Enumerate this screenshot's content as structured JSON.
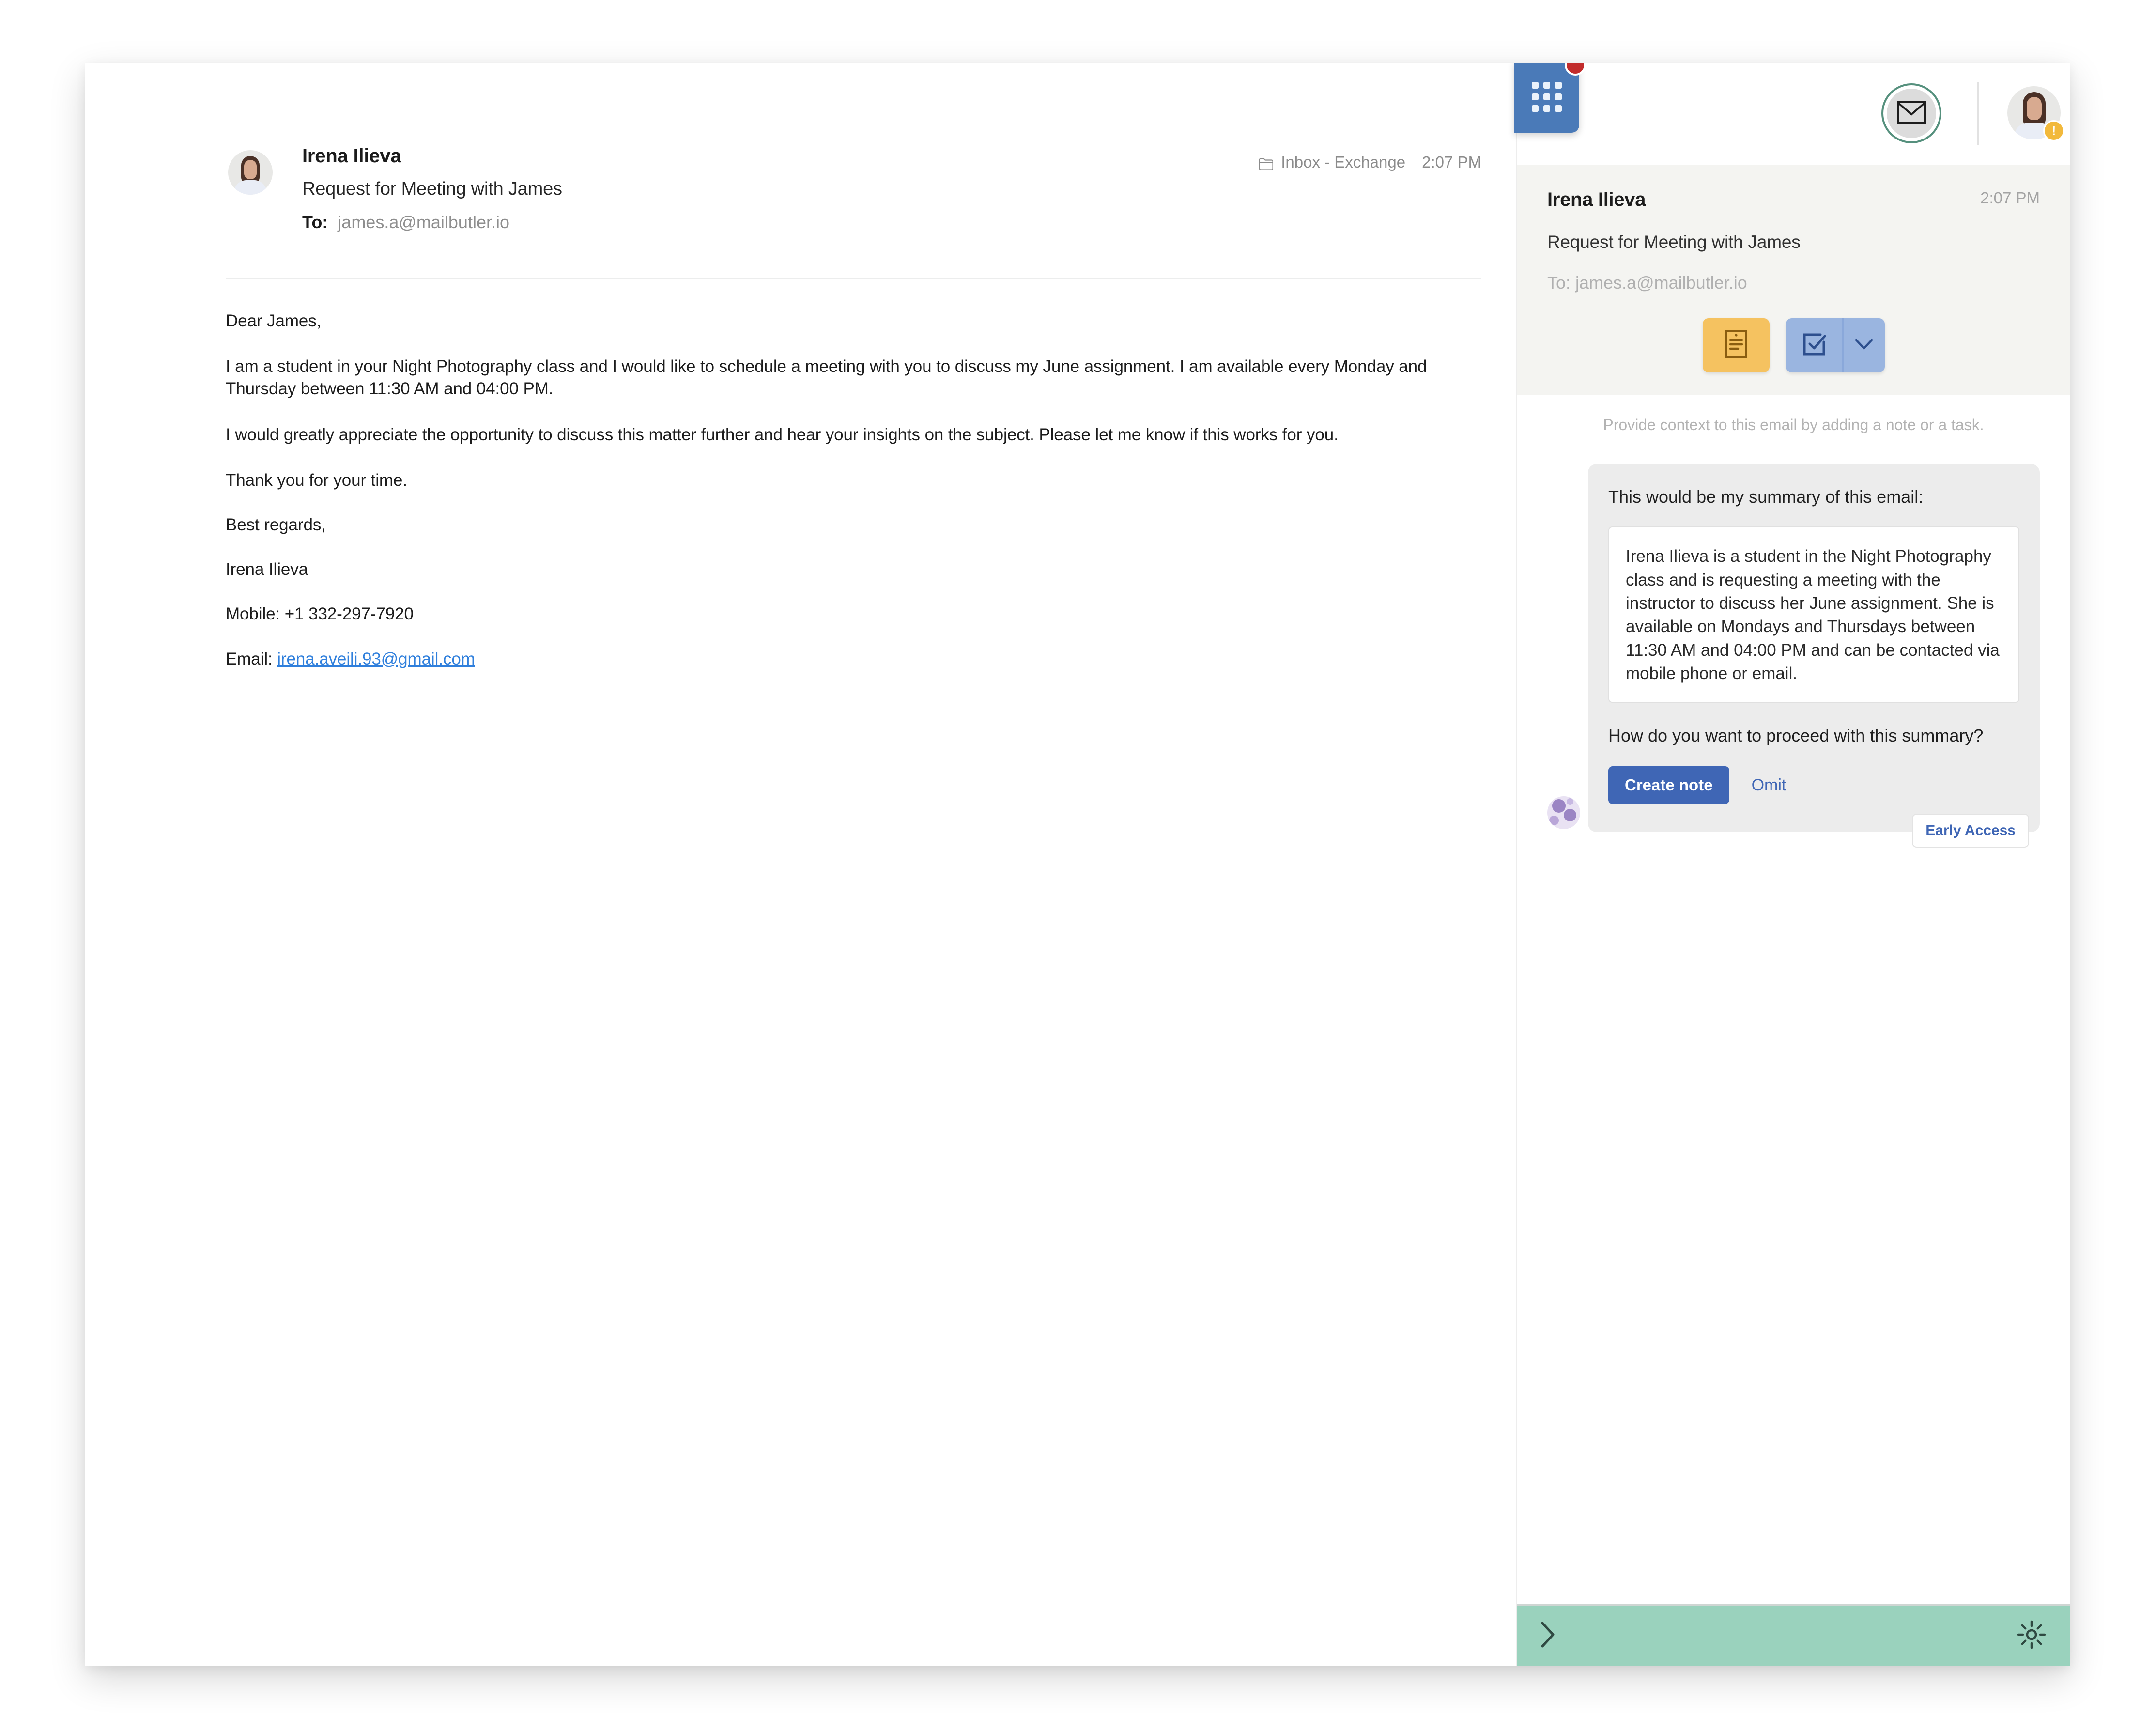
{
  "email": {
    "sender_name": "Irena Ilieva",
    "subject": "Request for Meeting with James",
    "to_label": "To:",
    "to_value": "james.a@mailbutler.io",
    "folder": "Inbox - Exchange",
    "time": "2:07 PM",
    "body": {
      "greeting": "Dear James,",
      "paragraph_1": "I am a student in your Night Photography class and I would like to schedule a meeting with you to discuss my June assignment. I am available every Monday and Thursday between 11:30 AM and 04:00 PM.",
      "paragraph_2": "I would greatly appreciate the opportunity to discuss this matter further and hear your insights on the subject. Please let me know if this works for you.",
      "paragraph_3": "Thank you for your time.",
      "closing": "Best regards,",
      "signature_name": "Irena Ilieva",
      "mobile": "Mobile: +1 332-297-7920",
      "email_label": "Email:",
      "email_link": "irena.aveili.93@gmail.com"
    }
  },
  "sidebar": {
    "sender_name": "Irena Ilieva",
    "time": "2:07 PM",
    "subject": "Request for Meeting with James",
    "to_line": "To: james.a@mailbutler.io",
    "hint": "Provide context to this email by adding a note or a task.",
    "chat": {
      "intro": "This would be my summary of this email:",
      "summary": "Irena Ilieva is a student in the Night Photography class and is requesting a meeting with the instructor to discuss her June assignment. She is available on Mondays and Thursdays between 11:30 AM and 04:00 PM and can be contacted via mobile phone or email.",
      "question": "How do you want to proceed with this summary?",
      "primary_button": "Create note",
      "secondary_button": "Omit",
      "badge": "Early Access"
    }
  },
  "colors": {
    "accent_blue": "#3f66b5",
    "note_yellow": "#f5c260",
    "task_blue": "#9ab5e0",
    "footer_green": "#9ad2bd",
    "mail_ring_green": "#55907d",
    "link_blue": "#2f7fdc",
    "notification_red": "#c22c2c",
    "warning_amber": "#f2b93c"
  }
}
